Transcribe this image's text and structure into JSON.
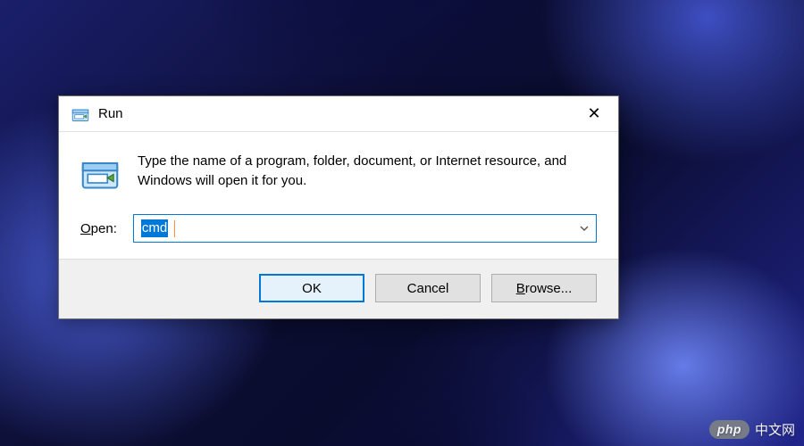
{
  "dialog": {
    "title": "Run",
    "description": "Type the name of a program, folder, document, or Internet resource, and Windows will open it for you.",
    "open_label_prefix": "O",
    "open_label_rest": "pen:",
    "input_value": "cmd",
    "buttons": {
      "ok": "OK",
      "cancel": "Cancel",
      "browse_prefix": "B",
      "browse_rest": "rowse..."
    },
    "close_glyph": "✕",
    "chevron_glyph": "⌄"
  },
  "watermark": {
    "badge": "php",
    "text": "中文网"
  }
}
